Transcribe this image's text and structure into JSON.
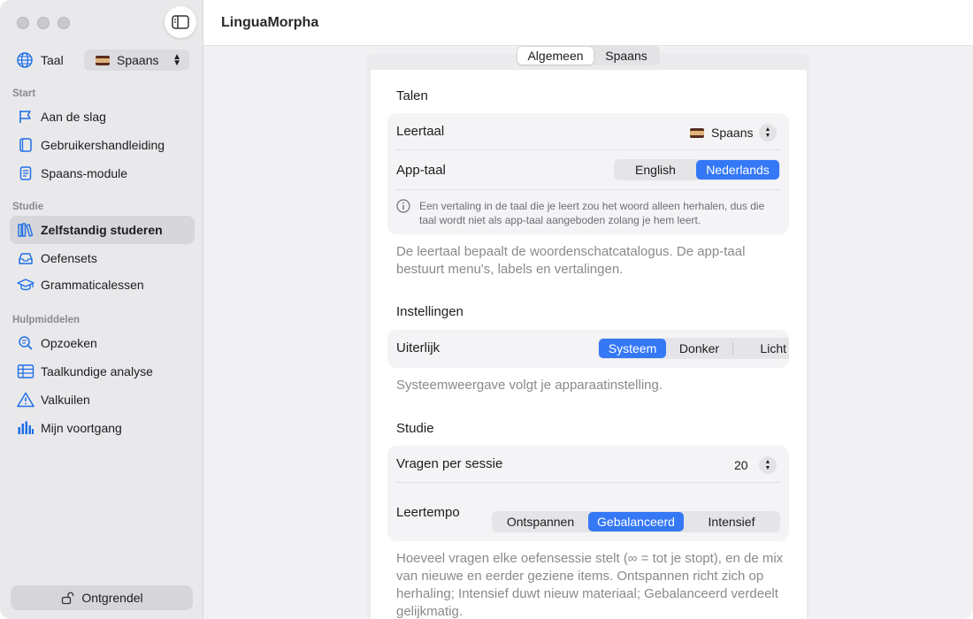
{
  "app": {
    "title": "LinguaMorpha"
  },
  "sidebar": {
    "language_label": "Taal",
    "language_value": "Spaans",
    "sections": {
      "start": "Start",
      "study": "Studie",
      "tools": "Hulpmiddelen"
    },
    "items": [
      {
        "label": "Aan de slag",
        "icon": "flag-icon"
      },
      {
        "label": "Gebruikershandleiding",
        "icon": "book-icon"
      },
      {
        "label": "Spaans-module",
        "icon": "document-icon"
      },
      {
        "label": "Zelfstandig studeren",
        "icon": "library-icon",
        "active": true
      },
      {
        "label": "Oefensets",
        "icon": "tray-icon"
      },
      {
        "label": "Grammaticalessen",
        "icon": "graduation-cap-icon"
      },
      {
        "label": "Opzoeken",
        "icon": "magnifier-icon"
      },
      {
        "label": "Taalkundige analyse",
        "icon": "table-icon"
      },
      {
        "label": "Valkuilen",
        "icon": "warning-icon"
      },
      {
        "label": "Mijn voortgang",
        "icon": "bar-chart-icon"
      }
    ],
    "unlock_label": "Ontgrendel"
  },
  "tabs": [
    "Algemeen",
    "Spaans"
  ],
  "talen": {
    "heading": "Talen",
    "leertaal_label": "Leertaal",
    "leertaal_value": "Spaans",
    "apptaal_label": "App-taal",
    "apptaal_options": [
      "English",
      "Nederlands"
    ],
    "apptaal_selected": "Nederlands",
    "info_note": "Een vertaling in de taal die je leert zou het woord alleen herhalen, dus die taal wordt niet als app-taal aangeboden zolang je hem leert.",
    "help": "De leertaal bepaalt de woordenschatcatalogus. De app-taal bestuurt menu's, labels en vertalingen."
  },
  "instellingen": {
    "heading": "Instellingen",
    "uiterlijk_label": "Uiterlijk",
    "uiterlijk_options": [
      "Systeem",
      "Donker",
      "Licht"
    ],
    "uiterlijk_selected": "Systeem",
    "help": "Systeemweergave volgt je apparaatinstelling."
  },
  "studie": {
    "heading": "Studie",
    "vragen_label": "Vragen per sessie",
    "vragen_value": "20",
    "tempo_label": "Leertempo",
    "tempo_options": [
      "Ontspannen",
      "Gebalanceerd",
      "Intensief"
    ],
    "tempo_selected": "Gebalanceerd",
    "help": "Hoeveel vragen elke oefensessie stelt (∞ = tot je stopt), en de mix van nieuwe en eerder geziene items. Ontspannen richt zich op herhaling; Intensief duwt nieuw materiaal; Gebalanceerd verdeelt gelijkmatig."
  },
  "colors": {
    "accent": "#3478f6",
    "sidebar_bg": "#e9e9ec"
  }
}
